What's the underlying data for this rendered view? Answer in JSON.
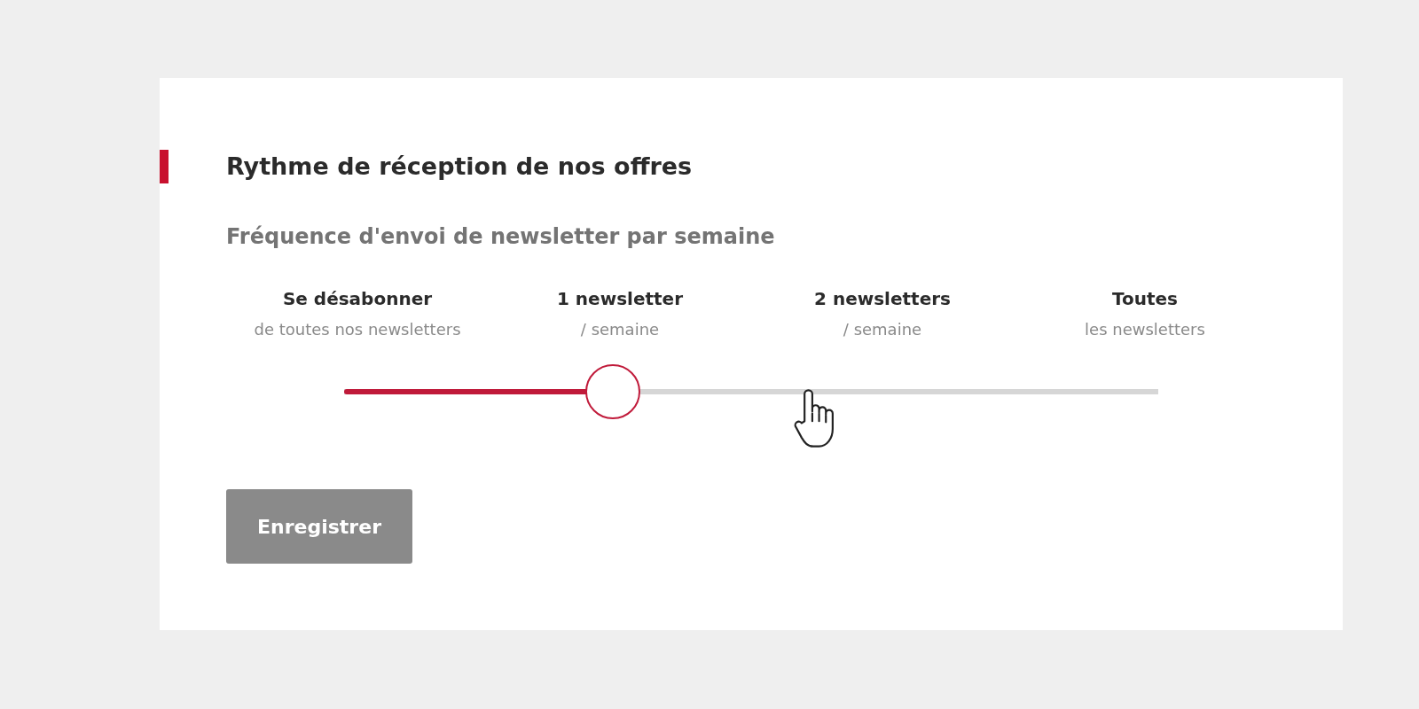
{
  "section": {
    "title": "Rythme de réception de nos offres",
    "subtitle": "Fréquence d'envoi de newsletter par semaine"
  },
  "frequency_slider": {
    "options": [
      {
        "label": "Se désabonner",
        "caption": "de toutes nos newsletters"
      },
      {
        "label": "1 newsletter",
        "caption": "/ semaine"
      },
      {
        "label": "2 newsletters",
        "caption": "/ semaine"
      },
      {
        "label": "Toutes",
        "caption": "les newsletters"
      }
    ],
    "level": 0.33
  },
  "save_button": {
    "label": "Enregistrer",
    "disabled": true
  }
}
